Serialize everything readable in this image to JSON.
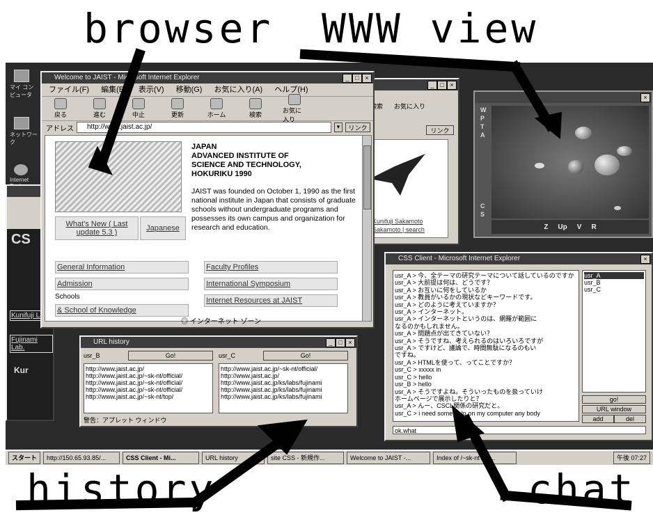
{
  "labels": {
    "browser": "browser",
    "www_view": "WWW view",
    "history": "history",
    "chat": "chat"
  },
  "colors": {
    "desktop": "#2a2a2a",
    "window_face": "#d4d0c8",
    "titlebar": "#3c3c3c"
  },
  "browser": {
    "title": "Welcome to JAIST - Microsoft Internet Explorer",
    "menu": [
      "ファイル(F)",
      "編集(E)",
      "表示(V)",
      "移動(G)",
      "お気に入り(A)",
      "ヘルプ(H)"
    ],
    "toolbar": [
      "戻る",
      "進む",
      "中止",
      "更新",
      "ホーム",
      "検索",
      "お気に入り"
    ],
    "address_label": "アドレス",
    "address": "http://www.jaist.ac.jp/",
    "links_btn": "リンク",
    "heading": "JAPAN\nADVANCED INSTITUTE OF\nSCIENCE AND TECHNOLOGY,\nHOKURIKU 1990",
    "body_text": "JAIST was founded on October 1, 1990 as the first national institute in Japan that consists of graduate schools without undergraduate programs and possesses its own campus and organization for research and education.",
    "whats_new": "What's New ( Last update 5.3 )",
    "japanese": "Japanese",
    "nav_left": [
      "General Information",
      "Admission",
      "Schools",
      "& School of Knowledge"
    ],
    "nav_right": [
      "Faculty Profiles",
      "International Symposium",
      "Internet Resources at JAIST"
    ],
    "status": "インターネット ゾーン"
  },
  "back_browser": {
    "links": [
      "Kunifuji Sakamoto",
      "Sakamoto | search"
    ],
    "links_btn": "リンク",
    "fav": "お気に入り",
    "search": "検索"
  },
  "desktop_icons": [
    "マイ コンピュータ",
    "ネットワーク",
    "Internet Explorer"
  ],
  "left_window": {
    "heading": "CS",
    "items": [
      "Kunifuji Lab.",
      "Fujinami Lab.",
      "Kur"
    ]
  },
  "www_view": {
    "side_letters": [
      "W",
      "P",
      "T",
      "A",
      "C",
      "S"
    ],
    "controls": [
      "Z",
      "Up",
      "V",
      "R"
    ]
  },
  "history": {
    "title": "URL history",
    "users": [
      "usr_B",
      "usr_C"
    ],
    "go_label": "Go!",
    "list_b": [
      "http://www.jaist.ac.jp/",
      "http://www.jaist.ac.jp/~sk-nt/official/",
      "http://www.jaist.ac.jp/~sk-nt/official/",
      "http://www.jaist.ac.jp/~sk-nt/official/",
      "http://www.jaist.ac.jp/~sk-nt/top/"
    ],
    "list_c": [
      "http://www.jaist.ac.jp/~sk-nt/official/",
      "http://www.jaist.ac.jp/",
      "http://www.jaist.ac.jp/ks/labs/fujinami",
      "http://www.jaist.ac.jp/ks/labs/fujinami",
      "http://www.jaist.ac.jp/ks/labs/fujinami"
    ],
    "status": "警告：アプレット ウィンドウ"
  },
  "chat": {
    "title": "CSS Client - Microsoft Internet Explorer",
    "users": [
      "usr_A",
      "usr_B",
      "usr_C"
    ],
    "lines": [
      "usr_A > 今、全テーマの研究テーマについて話しているのですか",
      "usr_A > 大前提は何は、どうです？",
      "usr_A > お互いに何をしているか",
      "usr_A > 教員がいるかの現状などキーワードです。",
      "usr_A > どのように考えていますか？",
      "usr_A > インターネット。",
      "usr_A > インターネットというのは、網羅が範囲に",
      "なるのかもしれません。",
      "usr_A > 問題点が出てきていない？",
      "usr_A > そうですね、考えられるのはいろいろですが",
      "usr_A > ですけど、議論で、時間無駄になるのもい",
      "ですね。",
      "usr_A > HTMLを使って、ってことですか？",
      "usr_C > xxxxx in",
      "usr_C > hello",
      "usr_B > hello",
      "usr_A > そうですよね。そういったものを扱っていけ",
      "ホームページで展示したりと？",
      "usr_A > んー、CSCL関係の研究だと。",
      "usr_C > i need some help on my computer any body"
    ],
    "buttons": [
      "go!",
      "URL window",
      "add",
      "del"
    ],
    "input_value": "ok.what"
  },
  "taskbar": [
    "スタート",
    "http://150.65.93.85/...",
    "CSS Client - Mi...",
    "URL history",
    "site CSS - 新規作...",
    "Welcome to JAIST -...",
    "Index of /~sk-nt /pu...",
    "午後 07:27"
  ]
}
